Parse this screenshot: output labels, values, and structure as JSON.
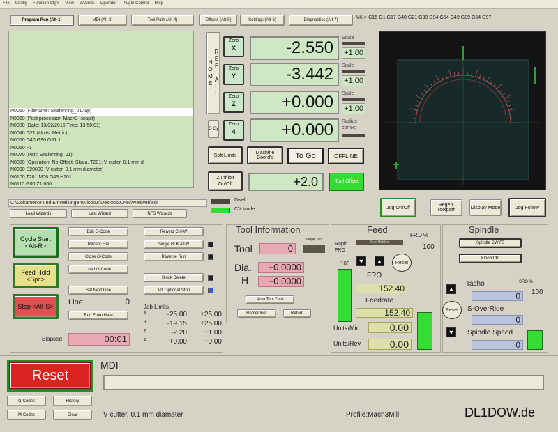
{
  "menu": [
    "File",
    "Config",
    "Function Cfg's",
    "View",
    "Wizards",
    "Operator",
    "PlugIn Control",
    "Help"
  ],
  "tabs": [
    "Program Run (Alt-1)",
    "MDI (Alt-2)",
    "Tool Path (Alt-4)",
    "Offsets (Alt-5)",
    "Settings (Alt-6)",
    "Diagnostics (Alt-7)"
  ],
  "mcodes": "M6-> G15  G1 G17 G40 G21 G90 G94 G54 G49 G99 G64 G97",
  "gcode_lines": [
    "N0010 (Filename: Skalenring_01.tap)",
    "N0020 (Post processor: Mach3_scapit)",
    "N0030 (Date: 13/02/2015 Time: 13:50:01)",
    "N0040 G21 (Units: Metric)",
    "N0050 G40 G90 G61.1",
    "N0060 F1",
    "N0070 (Part: Skalenring_01)",
    "N0080 (Operation: No Offset, Skala, T201: V cutter, 0.1 mm d",
    "N0090 S20000 (V cutter, 0.1 mm diameter)",
    "N0100 T201 M06 G43 H201",
    "N0110 G00 Z1.000"
  ],
  "file_path": "C:\\Dokumente und Einstellungen\\Nicolas\\Desktop\\CNN\\Weltweit\\scr",
  "file_buttons": [
    "Load Wizards",
    "Last Wizard",
    "NFS Wizards"
  ],
  "ref_all_home": "REF ALL HOME",
  "axes": [
    {
      "zero": "Zero",
      "axis": "X",
      "value": "-2.550",
      "scale_label": "Scale",
      "scale": "+1.00"
    },
    {
      "zero": "Zero",
      "axis": "Y",
      "value": "-3.442",
      "scale_label": "Scale",
      "scale": "+1.00"
    },
    {
      "zero": "Zero",
      "axis": "Z",
      "value": "+0.000",
      "scale_label": "Scale",
      "scale": "+1.00"
    },
    {
      "zero": "Zero",
      "axis": "4",
      "value": "+0.000",
      "scale_label": "Radius correct",
      "scale": ""
    }
  ],
  "gcode_btn": "G Gy",
  "soft_limits": "Soft Limits",
  "machine_coords": "Machine Coord's",
  "to_go": "To Go",
  "offline": "OFFLINE",
  "zinhibit": "Z Inhibit On/Off",
  "zinhibit_value": "+2.0",
  "dro_tool": "Tool Offset",
  "dwell_label": "Dwell",
  "cv_mode_label": "CV Mode",
  "toolpath_buttons": [
    "Jog On/Off",
    "Regen. Toolpath",
    "Display Mode",
    "Jog Follow"
  ],
  "program_buttons": [
    "Edit G-Code",
    "Recent File",
    "Close G-Code",
    "Load G-Code",
    "Set Next Line",
    "Run From Here"
  ],
  "right_buttons": [
    "Rewind Ctrl-W",
    "Single BLK Alt-N",
    "Reverse Run",
    "Block Delete",
    "M1 Optional Stop"
  ],
  "cycle_start": "Cycle Start <Alt-R>",
  "feed_hold": "Feed Hold <Spc>",
  "stop": "Stop <Alt-S>",
  "line_label": "Line:",
  "line_value": "0",
  "elapsed_label": "Elapsed",
  "elapsed_value": "00:01",
  "job_limits_title": "Job Limits",
  "job_limits": [
    {
      "axis": "X",
      "min": "-25.00",
      "max": "+25.00"
    },
    {
      "axis": "Y",
      "min": "-19.15",
      "max": "+25.00"
    },
    {
      "axis": "Z",
      "min": "-2.20",
      "max": "+1.00"
    },
    {
      "axis": "A",
      "min": "+0.00",
      "max": "+0.00"
    }
  ],
  "tool_info": {
    "title": "Tool Information",
    "tool_label": "Tool",
    "tool_value": "0",
    "change_label": "Change Tool",
    "dia_label": "Dia.",
    "dia_value": "+0.0000",
    "h_label": "H",
    "h_value": "+0.0000",
    "auto_zero": "Auto Tool Zero",
    "remember": "Remember",
    "return": "Return"
  },
  "feed": {
    "title": "Feed",
    "overridden": "OverRidden",
    "fro_pct_label": "FRO %",
    "fro_pct": "100",
    "rapid_label": "Rapid FRO",
    "rapid_value": "100",
    "reset": "Reset",
    "fro_label": "FRO",
    "fro_value": "152.40",
    "feedrate_label": "Feedrate",
    "feedrate_value": "152.40",
    "units_min_label": "Units/Min",
    "units_min_value": "0.00",
    "units_rev_label": "Units/Rev",
    "units_rev_value": "0.00"
  },
  "spindle": {
    "title": "Spindle",
    "cw": "Spindle CW F5",
    "flood": "Flood Ctrl",
    "tacho_label": "Tacho",
    "sro_label": "SRO %",
    "sro_value": "100",
    "tacho_value": "0",
    "reset": "Reset",
    "override_label": "S-OverRide",
    "override_value": "0",
    "speed_label": "Spindle Speed",
    "speed_value": "0"
  },
  "reset_big": "Reset",
  "mdi_label": "MDI",
  "bottom_buttons": [
    "G-Codes",
    "History",
    "M-Codes",
    "Clear"
  ],
  "status_text": "V cutter, 0.1 mm diameter",
  "profile_text": "Profile:Mach3Mill",
  "watermark": "DL1DOW.de"
}
